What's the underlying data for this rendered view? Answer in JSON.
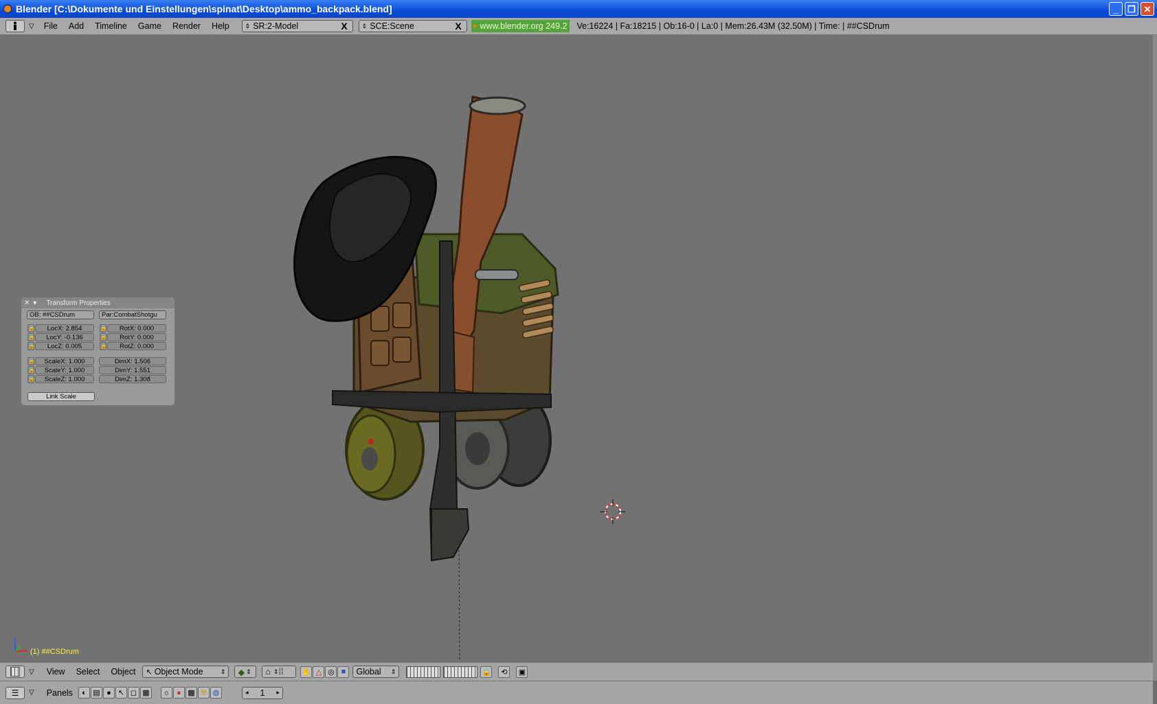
{
  "window": {
    "title": "Blender [C:\\Dokumente und Einstellungen\\spinat\\Desktop\\ammo_backpack.blend]",
    "minimize_glyph": "_",
    "maximize_glyph": "❐",
    "close_glyph": "✕"
  },
  "info_header": {
    "menus": [
      "File",
      "Add",
      "Timeline",
      "Game",
      "Render",
      "Help"
    ],
    "screen_field": "SR:2-Model",
    "scene_field": "SCE:Scene",
    "clear_glyph": "X",
    "version_label": "www.blender.org 249.2",
    "stats": "Ve:16224 | Fa:18215 | Ob:16-0 | La:0  | Mem:26.43M (32.50M)  | Time: | ##CSDrum"
  },
  "transform_panel": {
    "title": "Transform Properties",
    "object_name": "OB: ##CSDrum",
    "parent_name": "Par:CombatShotgu",
    "loc": [
      "LocX: 2.854",
      "LocY: -0.136",
      "LocZ: 0.005"
    ],
    "rot": [
      "RotX: 0.000",
      "RotY: 0.000",
      "RotZ: 0.000"
    ],
    "scale": [
      "ScaleX: 1.000",
      "ScaleY: 1.000",
      "ScaleZ: 1.000"
    ],
    "dim": [
      "DimX: 1.506",
      "DimY: 1.551",
      "DimZ: 1.308"
    ],
    "link_scale_label": "Link Scale"
  },
  "viewport": {
    "active_object_label": "(1) ##CSDrum",
    "background_color": "#727272"
  },
  "view3d_header": {
    "menus": [
      "View",
      "Select",
      "Object"
    ],
    "mode_select": "Object Mode",
    "orientation_select": "Global"
  },
  "buttons_header": {
    "panels_label": "Panels",
    "frame_value": "1"
  },
  "colors": {
    "title_blue": "#0a4bd6",
    "header_gray": "#a8a8a8",
    "version_green": "#55a43a",
    "active_label_yellow": "#ffee44"
  }
}
